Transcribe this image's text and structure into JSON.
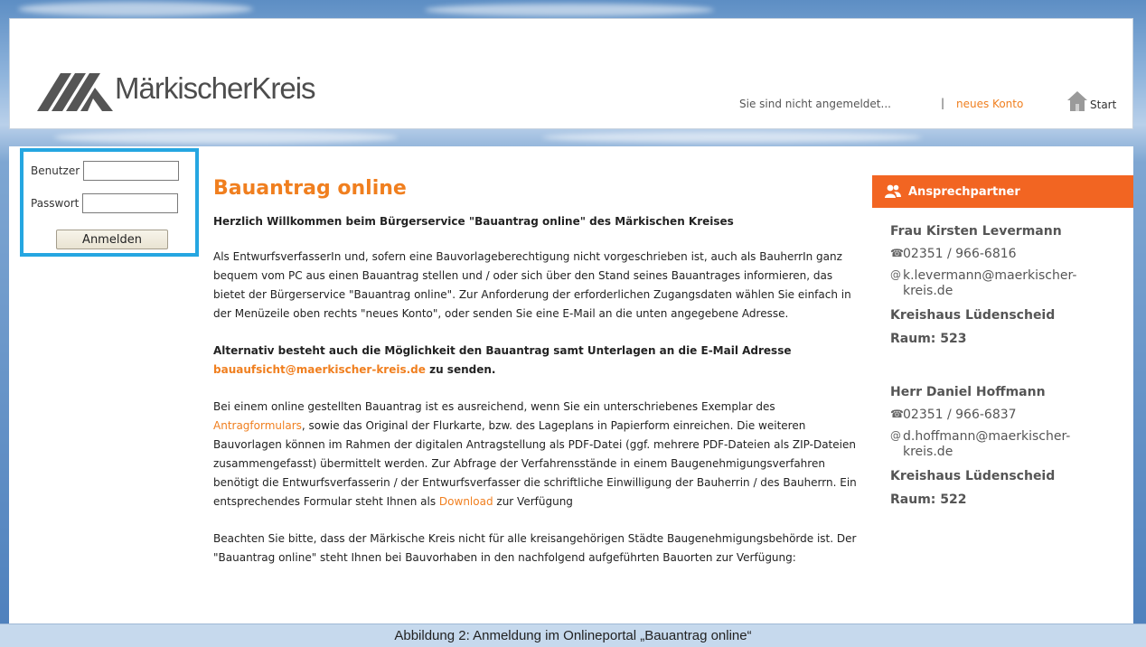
{
  "header": {
    "logo_text": "MärkischerKreis",
    "login_status": "Sie sind nicht angemeldet...",
    "separator": "|",
    "new_account_link": "neues Konto",
    "start_link": "Start",
    "icons": {
      "logo": "maerkischer-kreis-logo",
      "start": "home-icon"
    }
  },
  "login_box": {
    "user_label": "Benutzer",
    "user_value": "",
    "password_label": "Passwort",
    "password_value": "",
    "login_button": "Anmelden"
  },
  "article": {
    "title": "Bauantrag online",
    "lead": "Herzlich Willkommen beim Bürgerservice \"Bauantrag online\" des Märkischen Kreises",
    "p1": "Als EntwurfsverfasserIn und, sofern eine Bauvorlageberechtigung nicht vorgeschrieben ist, auch als BauherrIn ganz bequem vom PC aus einen Bauantrag stellen und / oder sich über den Stand seines Bauantrages informieren, das bietet der Bürgerservice \"Bauantrag online\". Zur Anforderung der erforderlichen Zugangsdaten wählen Sie einfach in der Menüzeile oben rechts \"neues Konto\", oder senden Sie eine E-Mail an die unten angegebene Adresse.",
    "p2_before": "Alternativ besteht auch die Möglichkeit den Bauantrag samt Unterlagen an die E-Mail Adresse ",
    "p2_email": "bauaufsicht@maerkischer-kreis.de",
    "p2_after": " zu senden.",
    "p3_before": "Bei einem online gestellten Bauantrag ist es ausreichend, wenn Sie ein unterschriebenes Exemplar des ",
    "p3_link": "Antragformulars",
    "p3_middle": ", sowie das Original der Flurkarte, bzw. des Lageplans in Papierform einreichen. Die weiteren Bauvorlagen können im Rahmen der digitalen Antragstellung als PDF-Datei (ggf. mehrere PDF-Dateien als ZIP-Dateien zusammengefasst) übermittelt werden. Zur Abfrage der Verfahrensstände in einem Baugenehmigungsverfahren benötigt die Entwurfsverfasserin / der Entwurfsverfasser die schriftliche Einwilligung der Bauherrin / des Bauherrn. Ein entsprechendes Formular steht Ihnen als ",
    "p3_download": "Download",
    "p3_after": " zur Verfügung",
    "p4": "Beachten Sie bitte, dass der Märkische Kreis nicht für alle kreisangehörigen Städte Baugenehmigungsbehörde ist. Der \"Bauantrag online\" steht Ihnen bei Bauvorhaben in den nachfolgend aufgeführten Bauorten zur Verfügung:"
  },
  "sidebar": {
    "title": "Ansprechpartner",
    "contacts": [
      {
        "name": "Frau Kirsten Levermann",
        "phone": "02351 / 966-6816",
        "email_line1": "k.levermann@maerkischer-",
        "email_line2": "kreis.de",
        "office": "Kreishaus Lüdenscheid",
        "room": "Raum: 523"
      },
      {
        "name": "Herr Daniel Hoffmann",
        "phone": "02351 / 966-6837",
        "email_line1": "d.hoffmann@maerkischer-",
        "email_line2": "kreis.de",
        "office": "Kreishaus Lüdenscheid",
        "room": "Raum: 522"
      }
    ]
  },
  "caption": "Abbildung 2: Anmeldung im Onlineportal „Bauantrag online“",
  "colors": {
    "accent": "#f07f1f",
    "sidebar_header": "#f26522",
    "highlight_border": "#25a6e1",
    "caption_bg": "#c6d9ed"
  }
}
